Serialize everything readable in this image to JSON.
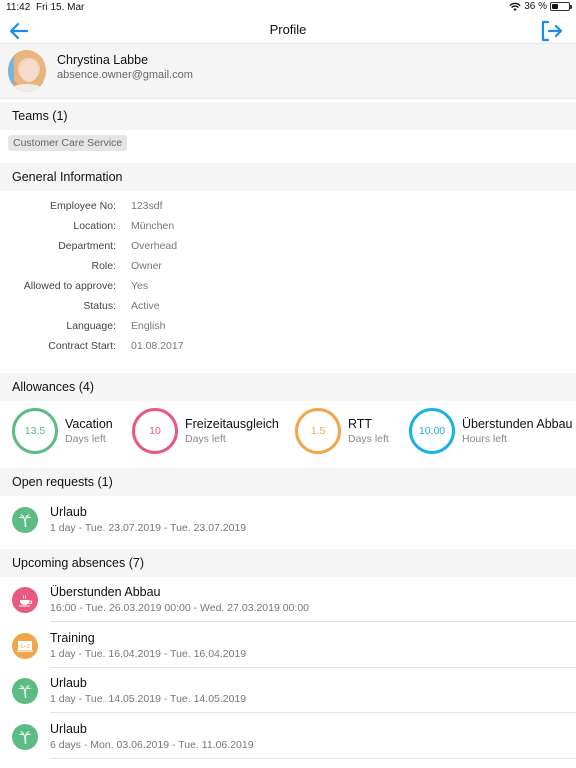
{
  "status_bar": {
    "time": "11:42",
    "date": "Fri 15. Mar",
    "battery_text": "36 %",
    "battery_level": 0.36
  },
  "nav": {
    "title": "Profile",
    "back_icon": "arrow-left-icon",
    "logout_icon": "logout-icon",
    "accent_color": "#1a8cf0"
  },
  "profile": {
    "name": "Chrystina Labbe",
    "email": "absence.owner@gmail.com"
  },
  "teams": {
    "header": "Teams (1)",
    "items": [
      "Customer Care Service"
    ]
  },
  "general": {
    "header": "General Information",
    "rows": [
      {
        "label": "Employee No:",
        "value": "123sdf"
      },
      {
        "label": "Location:",
        "value": "München"
      },
      {
        "label": "Department:",
        "value": "Overhead"
      },
      {
        "label": "Role:",
        "value": "Owner"
      },
      {
        "label": "Allowed to approve:",
        "value": "Yes"
      },
      {
        "label": "Status:",
        "value": "Active"
      },
      {
        "label": "Language:",
        "value": "English"
      },
      {
        "label": "Contract Start:",
        "value": "01.08.2017"
      }
    ]
  },
  "allowances": {
    "header": "Allowances (4)",
    "items": [
      {
        "value": "13.5",
        "name": "Vacation",
        "unit": "Days left",
        "color": "#5dbb84"
      },
      {
        "value": "10",
        "name": "Freizeitausgleich",
        "unit": "Days left",
        "color": "#e9587f"
      },
      {
        "value": "1.5",
        "name": "RTT",
        "unit": "Days left",
        "color": "#f2a54a"
      },
      {
        "value": "10:00",
        "name": "Überstunden Abbau",
        "unit": "Hours left",
        "color": "#1ab1e6"
      }
    ]
  },
  "open_requests": {
    "header": "Open requests (1)",
    "items": [
      {
        "title": "Urlaub",
        "subtitle": "1 day - Tue. 23.07.2019 - Tue. 23.07.2019",
        "icon": "palm-tree-icon",
        "color": "#5dbb84"
      }
    ]
  },
  "upcoming": {
    "header": "Upcoming absences (7)",
    "items": [
      {
        "title": "Überstunden Abbau",
        "subtitle": "16:00 - Tue. 26.03.2019 00:00 - Wed. 27.03.2019 00:00",
        "icon": "coffee-cup-icon",
        "color": "#e9587f"
      },
      {
        "title": "Training",
        "subtitle": "1 day - Tue. 16.04.2019 - Tue. 16.04.2019",
        "icon": "whiteboard-icon",
        "color": "#f2a54a"
      },
      {
        "title": "Urlaub",
        "subtitle": "1 day - Tue. 14.05.2019 - Tue. 14.05.2019",
        "icon": "palm-tree-icon",
        "color": "#5dbb84"
      },
      {
        "title": "Urlaub",
        "subtitle": "6 days - Mon. 03.06.2019 - Tue. 11.06.2019",
        "icon": "palm-tree-icon",
        "color": "#5dbb84"
      }
    ]
  }
}
